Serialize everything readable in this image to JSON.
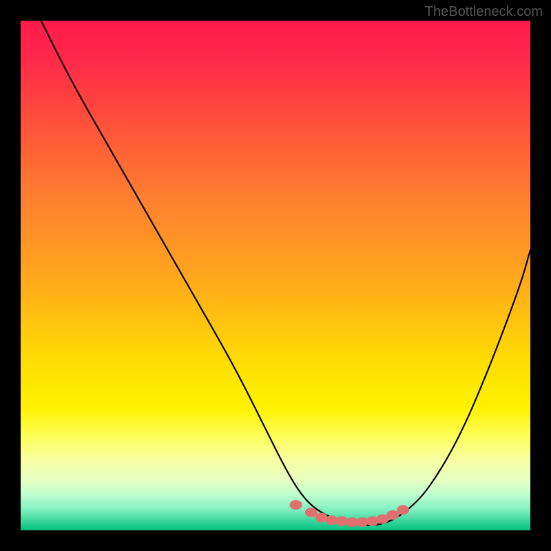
{
  "watermark": "TheBottleneck.com",
  "chart_data": {
    "type": "line",
    "title": "",
    "xlabel": "",
    "ylabel": "",
    "xlim": [
      0,
      100
    ],
    "ylim": [
      0,
      100
    ],
    "series": [
      {
        "name": "curve",
        "x": [
          4,
          10,
          18,
          26,
          34,
          42,
          48,
          52,
          55,
          58,
          62,
          66,
          70,
          73,
          76,
          80,
          86,
          92,
          98,
          100
        ],
        "values": [
          100,
          88,
          74,
          60,
          46,
          32,
          20,
          12,
          7,
          4,
          2,
          1,
          1,
          2,
          4,
          8,
          18,
          32,
          48,
          55
        ]
      }
    ],
    "markers": {
      "name": "bottom-cluster",
      "color": "#e07070",
      "x": [
        54,
        57,
        59,
        61,
        63,
        65,
        67,
        69,
        71,
        73,
        75
      ],
      "values": [
        5,
        3.5,
        2.5,
        2,
        1.8,
        1.6,
        1.6,
        1.8,
        2.2,
        3,
        4
      ]
    }
  }
}
